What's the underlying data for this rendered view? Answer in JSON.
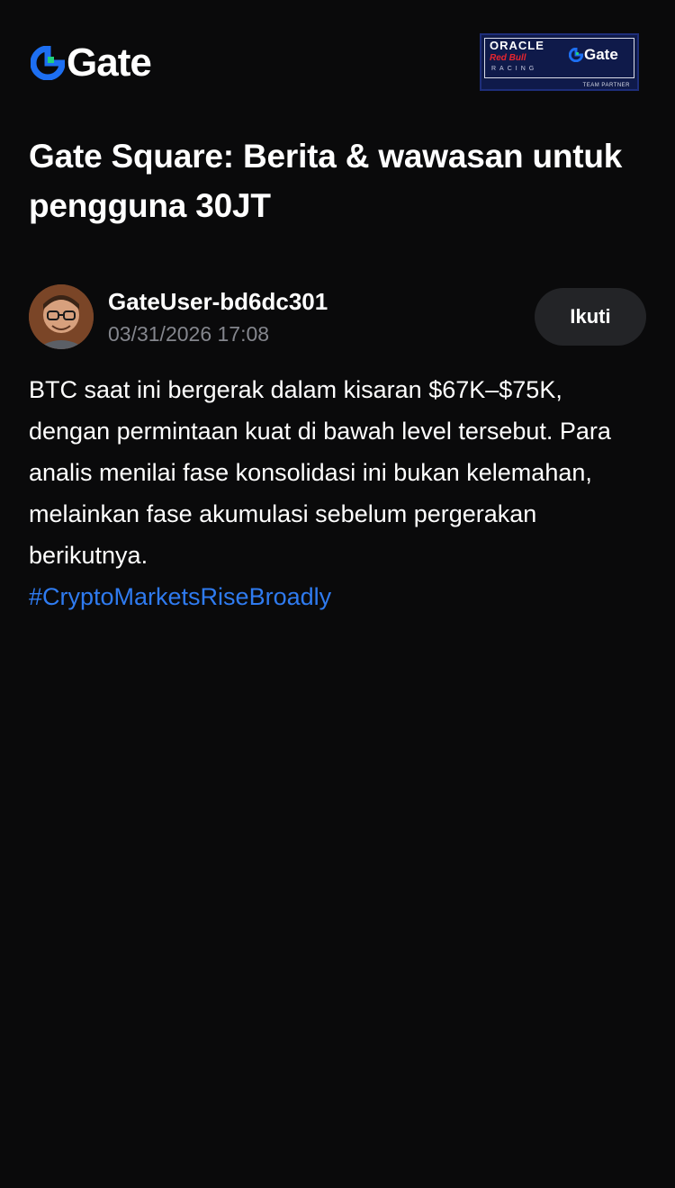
{
  "brand": {
    "name": "Gate",
    "accent": "#2f7bf0",
    "mark_color_primary": "#1d6ff2",
    "mark_color_secondary": "#21d37c"
  },
  "partner_badge": {
    "line1": "ORACLE",
    "line2": "Red Bull",
    "line3": "RACING",
    "brand": "Gate",
    "tag": "TEAM PARTNER"
  },
  "page": {
    "title": "Gate Square: Berita & wawasan untuk pengguna 30JT"
  },
  "post": {
    "author": "GateUser-bd6dc301",
    "timestamp": "03/31/2026 17:08",
    "follow_label": "Ikuti",
    "body": "BTC saat ini bergerak dalam kisaran $67K–$75K, dengan permintaan kuat di bawah level tersebut. Para analis menilai fase konsolidasi ini bukan kelemahan, melainkan fase akumulasi sebelum pergerakan berikutnya.",
    "hashtag": "#CryptoMarketsRiseBroadly"
  }
}
